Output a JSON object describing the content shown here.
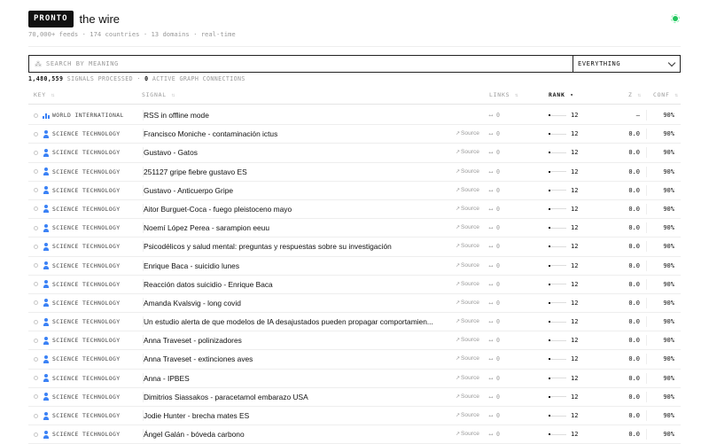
{
  "header": {
    "logo": "PRONTO",
    "title": "the wire",
    "subtitle": "70,000+ feeds · 174 countries · 13 domains · real-time",
    "live_icon": "live-pulse-icon",
    "live_color": "#22c55e"
  },
  "search": {
    "placeholder": "SEARCH BY MEANING",
    "value": "",
    "scope": "EVERYTHING"
  },
  "stats": {
    "signals": "1,480,559",
    "signals_label": "SIGNALS PROCESSED ·",
    "connections": "0",
    "connections_label": "ACTIVE GRAPH CONNECTIONS"
  },
  "table": {
    "sort": {
      "arrow": "▾",
      "idle": "⇅"
    },
    "columns": {
      "key": "KEY",
      "signal": "SIGNAL",
      "links": "LINKS",
      "rank": "RANK",
      "z": "Z",
      "conf": "CONF"
    },
    "rank_max": 100,
    "rows": [
      {
        "icon": "bar-chart-icon",
        "key": "WORLD INTERNATIONAL",
        "signal": "RSS in offline mode",
        "source": "",
        "links": "⟷ 0",
        "rank": 12,
        "rank_label": "12",
        "z": "—",
        "conf": "90%"
      },
      {
        "icon": "person-icon",
        "key": "SCIENCE TECHNOLOGY",
        "signal": "Francisco Moniche - contaminación ictus",
        "source": "Source",
        "links": "⟷ 0",
        "rank": 12,
        "rank_label": "12",
        "z": "0.0",
        "conf": "90%"
      },
      {
        "icon": "person-icon",
        "key": "SCIENCE TECHNOLOGY",
        "signal": "Gustavo - Gatos",
        "source": "Source",
        "links": "⟷ 0",
        "rank": 12,
        "rank_label": "12",
        "z": "0.0",
        "conf": "90%"
      },
      {
        "icon": "person-icon",
        "key": "SCIENCE TECHNOLOGY",
        "signal": "251127 gripe fiebre gustavo ES",
        "source": "Source",
        "links": "⟷ 0",
        "rank": 12,
        "rank_label": "12",
        "z": "0.0",
        "conf": "90%"
      },
      {
        "icon": "person-icon",
        "key": "SCIENCE TECHNOLOGY",
        "signal": "Gustavo - Anticuerpo Gripe",
        "source": "Source",
        "links": "⟷ 0",
        "rank": 12,
        "rank_label": "12",
        "z": "0.0",
        "conf": "90%"
      },
      {
        "icon": "person-icon",
        "key": "SCIENCE TECHNOLOGY",
        "signal": "Aitor Burguet-Coca - fuego pleistoceno mayo",
        "source": "Source",
        "links": "⟷ 0",
        "rank": 12,
        "rank_label": "12",
        "z": "0.0",
        "conf": "90%"
      },
      {
        "icon": "person-icon",
        "key": "SCIENCE TECHNOLOGY",
        "signal": "Noemí López Perea - sarampion eeuu",
        "source": "Source",
        "links": "⟷ 0",
        "rank": 12,
        "rank_label": "12",
        "z": "0.0",
        "conf": "90%"
      },
      {
        "icon": "person-icon",
        "key": "SCIENCE TECHNOLOGY",
        "signal": "Psicodélicos y salud mental: preguntas y respuestas sobre su investigación",
        "source": "Source",
        "links": "⟷ 0",
        "rank": 12,
        "rank_label": "12",
        "z": "0.0",
        "conf": "90%"
      },
      {
        "icon": "person-icon",
        "key": "SCIENCE TECHNOLOGY",
        "signal": "Enrique Baca - suicidio lunes",
        "source": "Source",
        "links": "⟷ 0",
        "rank": 12,
        "rank_label": "12",
        "z": "0.0",
        "conf": "90%"
      },
      {
        "icon": "person-icon",
        "key": "SCIENCE TECHNOLOGY",
        "signal": "Reacción datos suicidio - Enrique Baca",
        "source": "Source",
        "links": "⟷ 0",
        "rank": 12,
        "rank_label": "12",
        "z": "0.0",
        "conf": "90%"
      },
      {
        "icon": "person-icon",
        "key": "SCIENCE TECHNOLOGY",
        "signal": "Amanda Kvalsvig - long covid",
        "source": "Source",
        "links": "⟷ 0",
        "rank": 12,
        "rank_label": "12",
        "z": "0.0",
        "conf": "90%"
      },
      {
        "icon": "person-icon",
        "key": "SCIENCE TECHNOLOGY",
        "signal": "Un estudio alerta de que modelos de IA desajustados pueden propagar comportamien...",
        "source": "Source",
        "links": "⟷ 0",
        "rank": 12,
        "rank_label": "12",
        "z": "0.0",
        "conf": "90%"
      },
      {
        "icon": "person-icon",
        "key": "SCIENCE TECHNOLOGY",
        "signal": "Anna Traveset - polinizadores",
        "source": "Source",
        "links": "⟷ 0",
        "rank": 12,
        "rank_label": "12",
        "z": "0.0",
        "conf": "90%"
      },
      {
        "icon": "person-icon",
        "key": "SCIENCE TECHNOLOGY",
        "signal": "Anna Traveset - extinciones aves",
        "source": "Source",
        "links": "⟷ 0",
        "rank": 12,
        "rank_label": "12",
        "z": "0.0",
        "conf": "90%"
      },
      {
        "icon": "person-icon",
        "key": "SCIENCE TECHNOLOGY",
        "signal": "Anna - IPBES",
        "source": "Source",
        "links": "⟷ 0",
        "rank": 12,
        "rank_label": "12",
        "z": "0.0",
        "conf": "90%"
      },
      {
        "icon": "person-icon",
        "key": "SCIENCE TECHNOLOGY",
        "signal": "Dimitrios Siassakos - paracetamol embarazo USA",
        "source": "Source",
        "links": "⟷ 0",
        "rank": 12,
        "rank_label": "12",
        "z": "0.0",
        "conf": "90%"
      },
      {
        "icon": "person-icon",
        "key": "SCIENCE TECHNOLOGY",
        "signal": "Jodie Hunter - brecha mates ES",
        "source": "Source",
        "links": "⟷ 0",
        "rank": 12,
        "rank_label": "12",
        "z": "0.0",
        "conf": "90%"
      },
      {
        "icon": "person-icon",
        "key": "SCIENCE TECHNOLOGY",
        "signal": "Ángel Galán - bóveda carbono",
        "source": "Source",
        "links": "⟷ 0",
        "rank": 12,
        "rank_label": "12",
        "z": "0.0",
        "conf": "90%"
      }
    ]
  }
}
